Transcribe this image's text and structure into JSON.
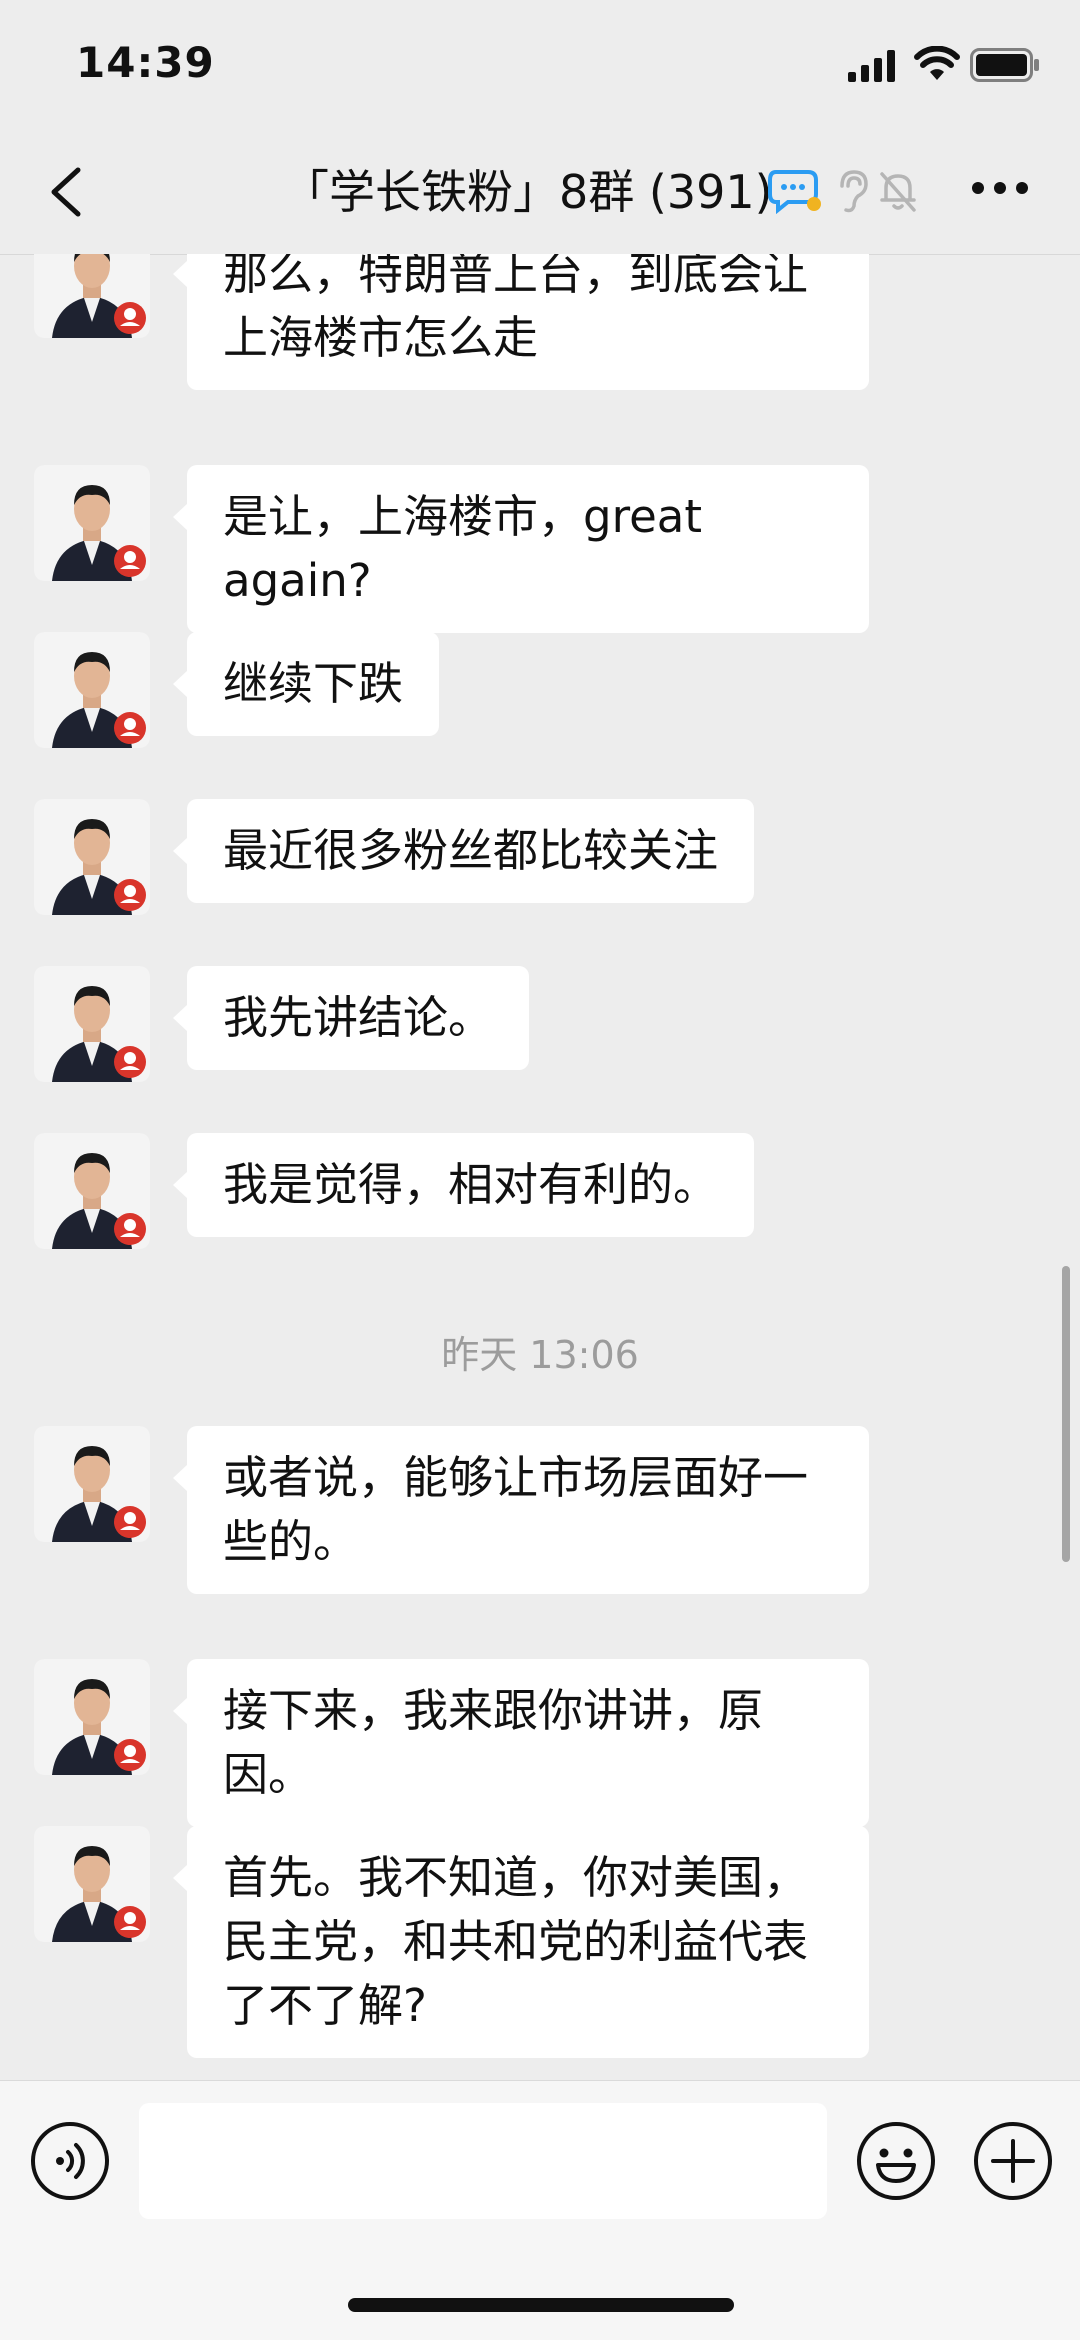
{
  "status_bar": {
    "time": "14:39"
  },
  "header": {
    "title": "「学长铁粉」8群 (391)"
  },
  "messages": [
    {
      "text": "那么，特朗普上台，到底会让上海楼市怎么走"
    },
    {
      "text": "是让，上海楼市，great again?"
    },
    {
      "text": "继续下跌"
    },
    {
      "text": "最近很多粉丝都比较关注"
    },
    {
      "text": "我先讲结论。"
    },
    {
      "text": "我是觉得，相对有利的。"
    },
    {
      "text": "或者说，能够让市场层面好一些的。"
    },
    {
      "text": "接下来，我来跟你讲讲，原因。"
    },
    {
      "text": "首先。我不知道，你对美国，民主党，和共和党的利益代表了不了解?"
    }
  ],
  "timestamp": "昨天 13:06",
  "colors": {
    "background": "#ededed",
    "bubble": "#ffffff",
    "input_bar": "#f6f6f6"
  },
  "icons": {
    "nav": [
      "back-icon",
      "chat-bubble-icon",
      "ear-icon",
      "mute-bell-icon",
      "more-icon"
    ],
    "input": [
      "voice-icon",
      "emoji-icon",
      "plus-icon"
    ]
  }
}
